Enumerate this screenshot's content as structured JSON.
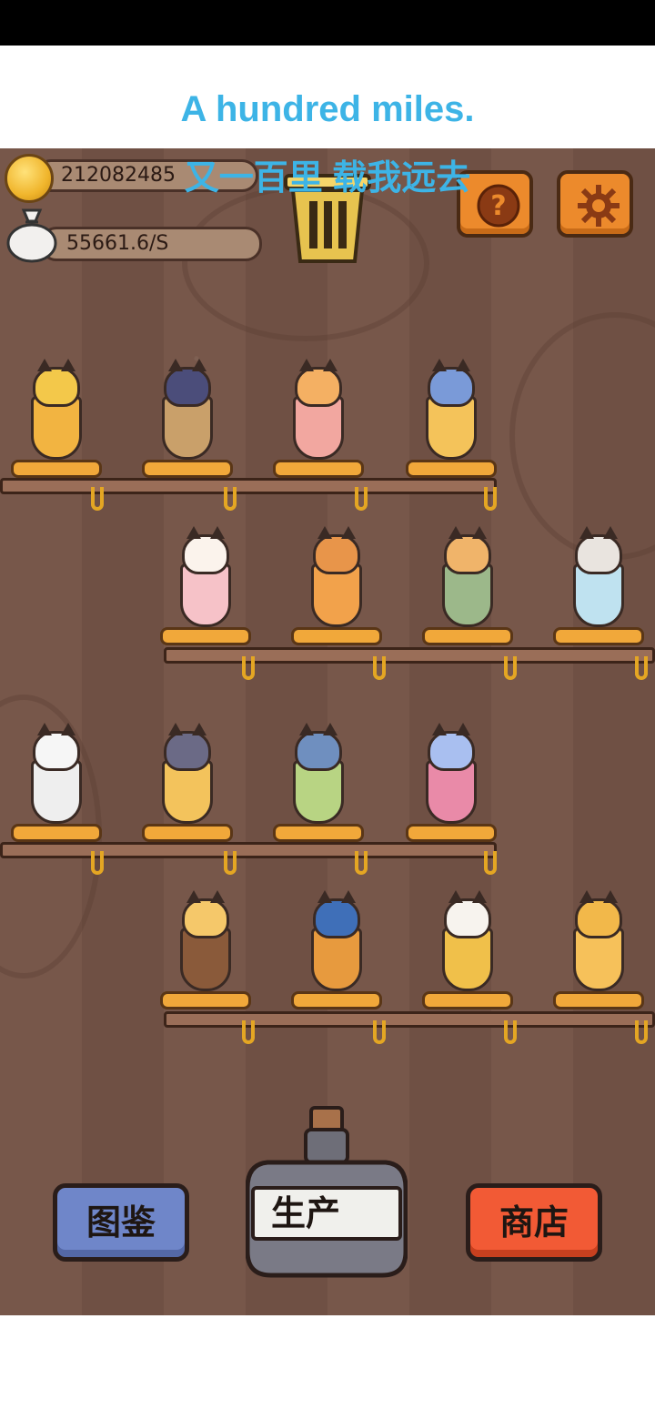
{
  "lyrics": {
    "english": "A hundred miles.",
    "chinese": "又一百里 载我远去"
  },
  "hud": {
    "coins": "212082485",
    "rate": "55661.6/S"
  },
  "icons": {
    "coin": "coin-icon",
    "money_bag": "money-bag-icon",
    "trash": "trash-icon",
    "help": "question-icon",
    "settings": "gear-icon"
  },
  "colors": {
    "lyric": "#3db4e6",
    "wood": "#725347",
    "orange_button": "#ec8a2c",
    "album_button": "#6f86c9",
    "shop_button": "#f25a35"
  },
  "buttons": {
    "album": "图鉴",
    "produce": "生产",
    "shop": "商店"
  }
}
